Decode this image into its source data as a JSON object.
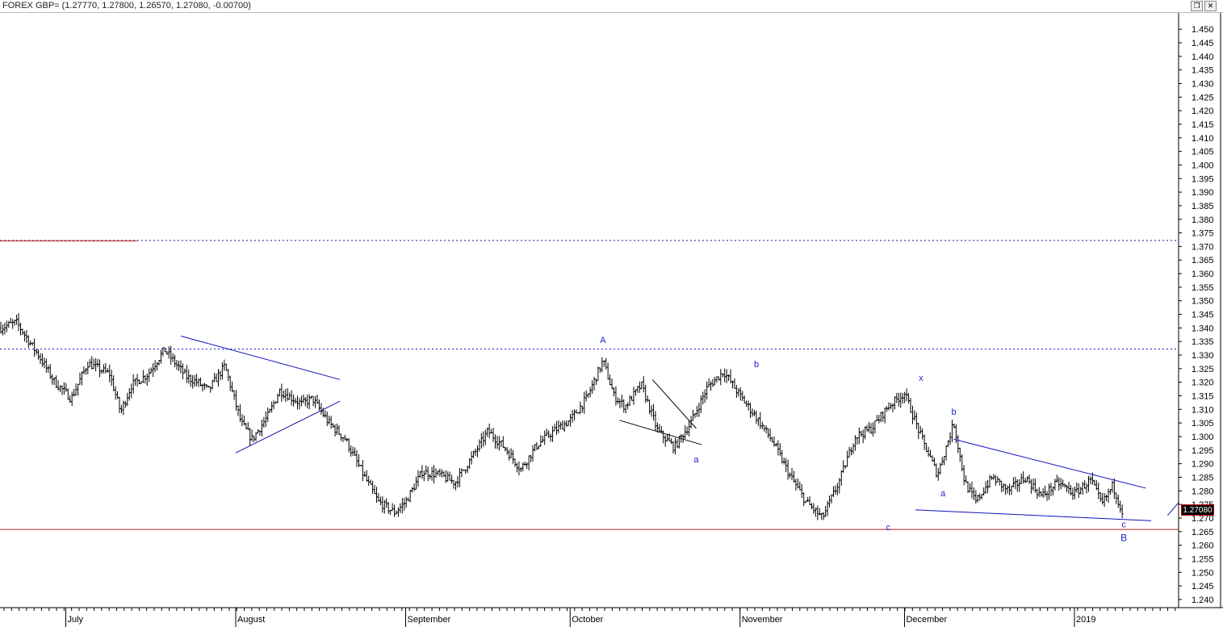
{
  "window": {
    "title": "FOREX GBP= (1.27770, 1.27800, 1.26570, 1.27080, -0.00700)",
    "restore_icon": "restore-icon",
    "close_icon": "close-icon",
    "restore_glyph": "❐",
    "close_glyph": "✕"
  },
  "chart_data": {
    "type": "candlestick",
    "symbol": "FOREX GBP=",
    "ohlc_last": {
      "open": 1.2777,
      "high": 1.278,
      "low": 1.2657,
      "close": 1.2708,
      "change": -0.007
    },
    "last_price_label": "1.27080",
    "ylim": [
      1.237,
      1.456
    ],
    "yticks": [
      "1.450",
      "1.445",
      "1.440",
      "1.435",
      "1.430",
      "1.425",
      "1.420",
      "1.415",
      "1.410",
      "1.405",
      "1.400",
      "1.395",
      "1.390",
      "1.385",
      "1.380",
      "1.375",
      "1.370",
      "1.365",
      "1.360",
      "1.355",
      "1.350",
      "1.345",
      "1.340",
      "1.335",
      "1.330",
      "1.325",
      "1.320",
      "1.315",
      "1.310",
      "1.305",
      "1.300",
      "1.295",
      "1.290",
      "1.285",
      "1.280",
      "1.275",
      "1.270",
      "1.265",
      "1.260",
      "1.255",
      "1.250",
      "1.245",
      "1.240"
    ],
    "x_range": [
      "2018-06-19",
      "2019-01-20"
    ],
    "xticks": [
      {
        "date": "2018-07-01",
        "label": "July"
      },
      {
        "date": "2018-08-01",
        "label": "August"
      },
      {
        "date": "2018-09-01",
        "label": "September"
      },
      {
        "date": "2018-10-01",
        "label": "October"
      },
      {
        "date": "2018-11-01",
        "label": "November"
      },
      {
        "date": "2018-12-01",
        "label": "December"
      },
      {
        "date": "2019-01-01",
        "label": "2019"
      }
    ],
    "daily_closes": [
      {
        "date": "2018-06-19",
        "close": 1.34
      },
      {
        "date": "2018-06-22",
        "close": 1.342
      },
      {
        "date": "2018-06-26",
        "close": 1.33
      },
      {
        "date": "2018-06-29",
        "close": 1.32
      },
      {
        "date": "2018-07-02",
        "close": 1.314
      },
      {
        "date": "2018-07-05",
        "close": 1.327
      },
      {
        "date": "2018-07-09",
        "close": 1.323
      },
      {
        "date": "2018-07-11",
        "close": 1.309
      },
      {
        "date": "2018-07-13",
        "close": 1.319
      },
      {
        "date": "2018-07-16",
        "close": 1.323
      },
      {
        "date": "2018-07-19",
        "close": 1.332
      },
      {
        "date": "2018-07-23",
        "close": 1.322
      },
      {
        "date": "2018-07-25",
        "close": 1.32
      },
      {
        "date": "2018-07-27",
        "close": 1.317
      },
      {
        "date": "2018-07-30",
        "close": 1.326
      },
      {
        "date": "2018-08-02",
        "close": 1.305
      },
      {
        "date": "2018-08-04",
        "close": 1.299
      },
      {
        "date": "2018-08-07",
        "close": 1.308
      },
      {
        "date": "2018-08-09",
        "close": 1.317
      },
      {
        "date": "2018-08-13",
        "close": 1.312
      },
      {
        "date": "2018-08-15",
        "close": 1.314
      },
      {
        "date": "2018-08-18",
        "close": 1.305
      },
      {
        "date": "2018-08-21",
        "close": 1.299
      },
      {
        "date": "2018-08-24",
        "close": 1.287
      },
      {
        "date": "2018-08-27",
        "close": 1.276
      },
      {
        "date": "2018-08-30",
        "close": 1.272
      },
      {
        "date": "2018-09-01",
        "close": 1.276
      },
      {
        "date": "2018-09-04",
        "close": 1.287
      },
      {
        "date": "2018-09-07",
        "close": 1.286
      },
      {
        "date": "2018-09-10",
        "close": 1.283
      },
      {
        "date": "2018-09-13",
        "close": 1.292
      },
      {
        "date": "2018-09-16",
        "close": 1.302
      },
      {
        "date": "2018-09-19",
        "close": 1.296
      },
      {
        "date": "2018-09-22",
        "close": 1.288
      },
      {
        "date": "2018-09-25",
        "close": 1.297
      },
      {
        "date": "2018-09-28",
        "close": 1.302
      },
      {
        "date": "2018-10-01",
        "close": 1.306
      },
      {
        "date": "2018-10-04",
        "close": 1.314
      },
      {
        "date": "2018-10-07",
        "close": 1.328
      },
      {
        "date": "2018-10-09",
        "close": 1.315
      },
      {
        "date": "2018-10-11",
        "close": 1.311
      },
      {
        "date": "2018-10-14",
        "close": 1.319
      },
      {
        "date": "2018-10-17",
        "close": 1.302
      },
      {
        "date": "2018-10-20",
        "close": 1.296
      },
      {
        "date": "2018-10-23",
        "close": 1.305
      },
      {
        "date": "2018-10-26",
        "close": 1.318
      },
      {
        "date": "2018-10-29",
        "close": 1.324
      },
      {
        "date": "2018-11-01",
        "close": 1.315
      },
      {
        "date": "2018-11-04",
        "close": 1.307
      },
      {
        "date": "2018-11-07",
        "close": 1.298
      },
      {
        "date": "2018-11-10",
        "close": 1.286
      },
      {
        "date": "2018-11-13",
        "close": 1.276
      },
      {
        "date": "2018-11-16",
        "close": 1.27
      },
      {
        "date": "2018-11-19",
        "close": 1.283
      },
      {
        "date": "2018-11-22",
        "close": 1.3
      },
      {
        "date": "2018-11-25",
        "close": 1.303
      },
      {
        "date": "2018-11-28",
        "close": 1.311
      },
      {
        "date": "2018-12-01",
        "close": 1.316
      },
      {
        "date": "2018-12-04",
        "close": 1.3
      },
      {
        "date": "2018-12-07",
        "close": 1.286
      },
      {
        "date": "2018-12-10",
        "close": 1.305
      },
      {
        "date": "2018-12-12",
        "close": 1.283
      },
      {
        "date": "2018-12-14",
        "close": 1.276
      },
      {
        "date": "2018-12-17",
        "close": 1.285
      },
      {
        "date": "2018-12-20",
        "close": 1.28
      },
      {
        "date": "2018-12-23",
        "close": 1.285
      },
      {
        "date": "2018-12-26",
        "close": 1.278
      },
      {
        "date": "2018-12-29",
        "close": 1.283
      },
      {
        "date": "2019-01-01",
        "close": 1.279
      },
      {
        "date": "2019-01-04",
        "close": 1.284
      },
      {
        "date": "2019-01-06",
        "close": 1.275
      },
      {
        "date": "2019-01-08",
        "close": 1.282
      },
      {
        "date": "2019-01-10",
        "close": 1.2708
      }
    ],
    "horizontal_lines": [
      {
        "price": 1.3722,
        "style": "dotted",
        "color": "#1010c0"
      },
      {
        "price": 1.3322,
        "style": "dotted",
        "color": "#1010c0"
      },
      {
        "price": 1.2658,
        "style": "solid",
        "color": "#c02020"
      },
      {
        "price": 1.372,
        "style": "solid",
        "color": "#c02020",
        "x_end": "2018-07-14"
      }
    ],
    "trendlines": [
      {
        "from": {
          "date": "2018-07-22",
          "price": 1.337
        },
        "to": {
          "date": "2018-08-20",
          "price": 1.321
        },
        "color": "#1010c0"
      },
      {
        "from": {
          "date": "2018-08-01",
          "price": 1.294
        },
        "to": {
          "date": "2018-08-20",
          "price": 1.313
        },
        "color": "#1010c0"
      },
      {
        "from": {
          "date": "2018-10-10",
          "price": 1.306
        },
        "to": {
          "date": "2018-10-25",
          "price": 1.297
        },
        "color": "#000000"
      },
      {
        "from": {
          "date": "2018-10-16",
          "price": 1.321
        },
        "to": {
          "date": "2018-10-24",
          "price": 1.303
        },
        "color": "#000000"
      },
      {
        "from": {
          "date": "2018-12-10",
          "price": 1.299
        },
        "to": {
          "date": "2019-01-14",
          "price": 1.281
        },
        "color": "#1010c0"
      },
      {
        "from": {
          "date": "2018-12-03",
          "price": 1.273
        },
        "to": {
          "date": "2019-01-15",
          "price": 1.269
        },
        "color": "#1010c0"
      },
      {
        "from": {
          "date": "2019-01-18",
          "price": 1.271
        },
        "to": {
          "date": "2019-03-01",
          "price": 1.369
        },
        "color": "#1010c0"
      }
    ],
    "annotations": [
      {
        "text": "A",
        "date": "2018-10-07",
        "price": 1.3345
      },
      {
        "text": "a",
        "date": "2018-10-24",
        "price": 1.2905
      },
      {
        "text": "b",
        "date": "2018-11-04",
        "price": 1.3255
      },
      {
        "text": "c",
        "date": "2018-11-28",
        "price": 1.2655
      },
      {
        "text": "x",
        "date": "2018-12-04",
        "price": 1.3205
      },
      {
        "text": "b",
        "date": "2018-12-10",
        "price": 1.308
      },
      {
        "text": "a",
        "date": "2018-12-08",
        "price": 1.278
      },
      {
        "text": "c",
        "date": "2019-01-10",
        "price": 1.2665
      },
      {
        "text": "B",
        "date": "2019-01-10",
        "price": 1.2615
      }
    ],
    "grid": false,
    "colors": {
      "bars": "#000000",
      "annotation": "#1a1acc",
      "support": "#c02020"
    }
  }
}
